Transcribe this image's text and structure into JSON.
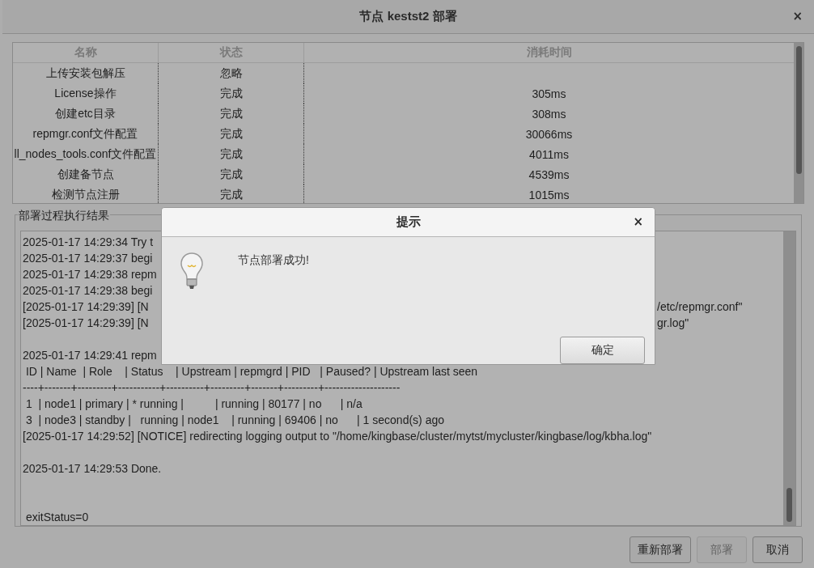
{
  "window": {
    "title": "节点 kestst2 部署",
    "close": "×"
  },
  "table": {
    "columns": [
      "名称",
      "状态",
      "消耗时间"
    ],
    "rows": [
      {
        "name": "上传安装包解压",
        "status": "忽略"
      },
      {
        "name": "License操作",
        "status": "完成",
        "time": "305ms"
      },
      {
        "name": "创建etc目录",
        "status": "完成",
        "time": "308ms"
      },
      {
        "name": "repmgr.conf文件配置",
        "status": "完成",
        "time": "30066ms"
      },
      {
        "name": "ll_nodes_tools.conf文件配置",
        "status": "完成",
        "time": "4011ms"
      },
      {
        "name": "创建备节点",
        "status": "完成",
        "time": "4539ms"
      },
      {
        "name": "检测节点注册",
        "status": "完成",
        "time": "1015ms"
      }
    ]
  },
  "log": {
    "title": "部署过程执行结果",
    "lines": [
      {
        "kind": "split",
        "left": "2025-01-17 14:29:34 Try t"
      },
      {
        "kind": "split",
        "left": "2025-01-17 14:29:37 begi"
      },
      {
        "kind": "split",
        "left": "2025-01-17 14:29:38 repm"
      },
      {
        "kind": "split",
        "left": "2025-01-17 14:29:38 begi"
      },
      {
        "kind": "split",
        "left": "[2025-01-17 14:29:39] [N",
        "right": "/etc/repmgr.conf\""
      },
      {
        "kind": "split",
        "left": "[2025-01-17 14:29:39] [N",
        "right": "gr.log\""
      },
      {
        "kind": "blank"
      },
      {
        "kind": "split",
        "left": "2025-01-17 14:29:41 repm"
      },
      {
        "kind": "line",
        "text": " ID | Name  | Role    | Status    | Upstream | repmgrd | PID   | Paused? | Upstream last seen"
      },
      {
        "kind": "line",
        "text": "----+-------+---------+-----------+----------+---------+-------+---------+--------------------"
      },
      {
        "kind": "line",
        "text": " 1  | node1 | primary | * running |          | running | 80177 | no      | n/a"
      },
      {
        "kind": "line",
        "text": " 3  | node3 | standby |   running | node1    | running | 69406 | no      | 1 second(s) ago"
      },
      {
        "kind": "line",
        "text": "[2025-01-17 14:29:52] [NOTICE] redirecting logging output to \"/home/kingbase/cluster/mytst/mycluster/kingbase/log/kbha.log\""
      },
      {
        "kind": "blank"
      },
      {
        "kind": "line",
        "text": "2025-01-17 14:29:53 Done."
      },
      {
        "kind": "blank"
      },
      {
        "kind": "blank"
      },
      {
        "kind": "line",
        "text": " exitStatus=0"
      }
    ]
  },
  "buttons": [
    {
      "label": "重新部署",
      "disabled": false
    },
    {
      "label": "部署",
      "disabled": true
    },
    {
      "label": "取消",
      "disabled": false
    }
  ],
  "dialog": {
    "title": "提示",
    "close": "×",
    "message": "节点部署成功!",
    "button": "确定"
  }
}
